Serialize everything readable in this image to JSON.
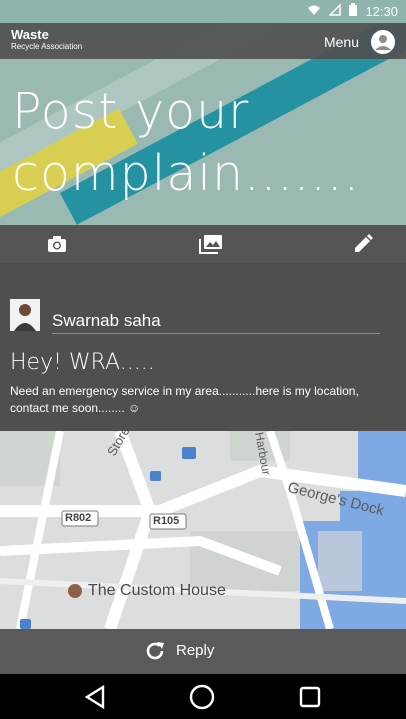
{
  "status_bar": {
    "time": "12:30"
  },
  "app": {
    "title": "Waste",
    "subtitle": "Recycle Association",
    "menu_label": "Menu"
  },
  "hero": {
    "headline_line1": "Post your",
    "headline_line2": "complain......."
  },
  "toolbar": {
    "icons": [
      "camera-icon",
      "gallery-icon",
      "edit-icon"
    ]
  },
  "post": {
    "username": "Swarnab saha",
    "title": "Hey! WRA.....",
    "body": "Need an emergency service in my area...........here is my location, contact me soon........ ☺"
  },
  "map": {
    "labels": [
      "Store St",
      "Harbour",
      "George's Dock",
      "R802",
      "R105",
      "The Custom House"
    ]
  },
  "reply": {
    "label": "Reply"
  },
  "colors": {
    "accent_line": "#3aa3d8",
    "water": "#7fa9e2",
    "bar": "#555555"
  }
}
